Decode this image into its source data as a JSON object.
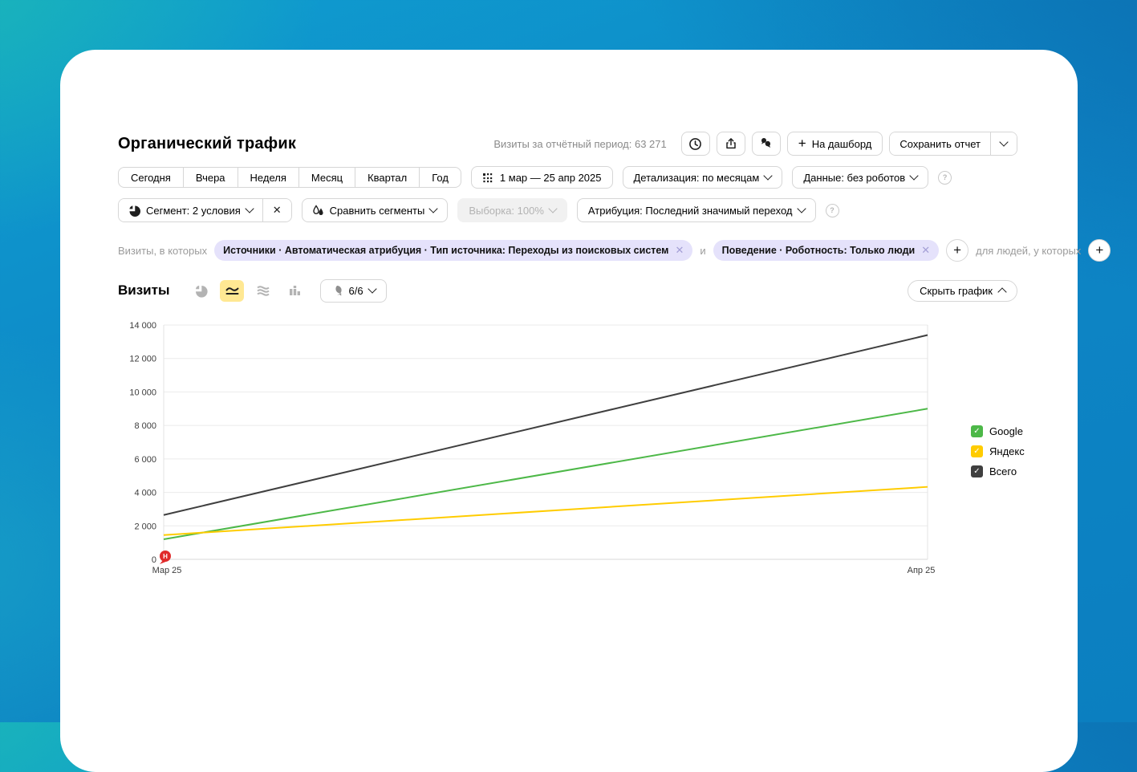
{
  "page": {
    "title": "Органический трафик",
    "visits_meta": "Визиты за отчётный период: 63 271"
  },
  "header": {
    "dashboard_button": "На дашборд",
    "save_report_button": "Сохранить отчет",
    "icons": [
      "history-clock",
      "export-share",
      "comments"
    ]
  },
  "period_tabs": [
    "Сегодня",
    "Вчера",
    "Неделя",
    "Месяц",
    "Квартал",
    "Год"
  ],
  "date_range": "1 мар — 25 апр 2025",
  "detail_dropdown": "Детализация: по месяцам",
  "data_dropdown": "Данные: без роботов",
  "segments": {
    "segment_label": "Сегмент: 2 условия",
    "compare_label": "Сравнить сегменты",
    "sampling_label": "Выборка: 100%",
    "attribution_label": "Атрибуция: Последний значимый переход"
  },
  "filters": {
    "prefix": "Визиты, в которых",
    "chips": [
      "Источники · Автоматическая атрибуция · Тип источника: Переходы из поисковых систем",
      "Поведение · Роботность: Только люди"
    ],
    "conjunction": "и",
    "suffix": "для людей, у которых"
  },
  "metric": {
    "label": "Визиты",
    "annotations_count": "6/6",
    "hide_chart_label": "Скрыть график"
  },
  "chart_data": {
    "type": "line",
    "x": [
      "Мар 25",
      "Апр 25"
    ],
    "series": [
      {
        "name": "Google",
        "color": "#4db848",
        "values": [
          1200,
          9000
        ]
      },
      {
        "name": "Яндекс",
        "color": "#ffcc00",
        "values": [
          1450,
          4330
        ]
      },
      {
        "name": "Всего",
        "color": "#3f3f3f",
        "values": [
          2650,
          13400
        ]
      }
    ],
    "ylim": [
      0,
      14000
    ],
    "yticks": [
      "0",
      "2 000",
      "4 000",
      "6 000",
      "8 000",
      "10 000",
      "12 000",
      "14 000"
    ],
    "grid": true,
    "legend_position": "right",
    "note_marker": {
      "label": "Н",
      "x": "Мар 25",
      "color": "#e02b2b"
    }
  }
}
